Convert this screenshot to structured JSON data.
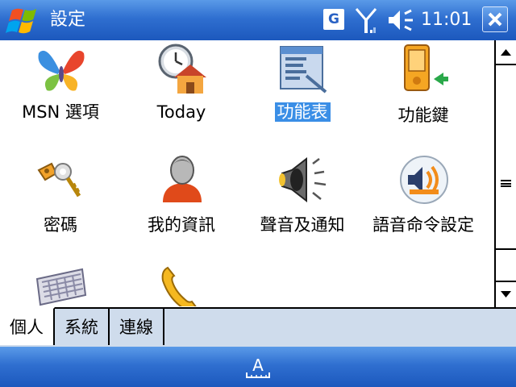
{
  "title_bar": {
    "title": "設定",
    "network_letter": "G",
    "time": "11:01",
    "icons": [
      "windows-start-icon",
      "signal-icon",
      "volume-icon",
      "close-icon"
    ]
  },
  "items": [
    {
      "label": "MSN 選項",
      "icon": "msn-butterfly-icon",
      "selected": false
    },
    {
      "label": "Today",
      "icon": "today-clock-home-icon",
      "selected": false
    },
    {
      "label": "功能表",
      "icon": "menus-icon",
      "selected": true
    },
    {
      "label": "功能鍵",
      "icon": "buttons-device-icon",
      "selected": false
    },
    {
      "label": "密碼",
      "icon": "keys-icon",
      "selected": false
    },
    {
      "label": "我的資訊",
      "icon": "owner-info-icon",
      "selected": false
    },
    {
      "label": "聲音及通知",
      "icon": "speaker-icon",
      "selected": false
    },
    {
      "label": "語音命令設定",
      "icon": "voice-command-icon",
      "selected": false
    },
    {
      "label": "",
      "icon": "keyboard-input-icon",
      "selected": false
    },
    {
      "label": "",
      "icon": "phone-icon",
      "selected": false
    }
  ],
  "tabs": [
    {
      "label": "個人",
      "active": true
    },
    {
      "label": "系統",
      "active": false
    },
    {
      "label": "連線",
      "active": false
    }
  ],
  "bottom_bar": {
    "sip_letter": "A"
  },
  "colors": {
    "titlebar": "#2f6fd0",
    "selection": "#3a8ee6",
    "tabstrip": "#cfdcec"
  }
}
